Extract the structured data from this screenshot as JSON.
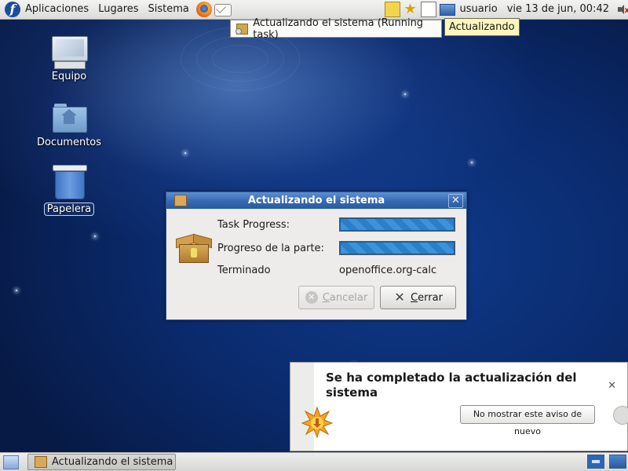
{
  "top_panel": {
    "menus": [
      "Aplicaciones",
      "Lugares",
      "Sistema"
    ],
    "launchers": [
      "firefox-icon",
      "mail-icon"
    ],
    "tray_icons": [
      "note-icon",
      "star-icon",
      "document-icon",
      "network-icon"
    ],
    "user": "usuario",
    "clock": "vie 13 de jun, 00:42",
    "volume": "volume-muted-icon"
  },
  "tooltips": {
    "running_task": "Actualizando el sistema (Running task)",
    "hover": "Actualizando"
  },
  "desktop_icons": [
    {
      "label": "Equipo",
      "icon": "computer-icon"
    },
    {
      "label": "Documentos",
      "icon": "home-folder-icon"
    },
    {
      "label": "Papelera",
      "icon": "trash-icon",
      "selected": true
    }
  ],
  "dialog": {
    "title": "Actualizando el sistema",
    "rows": [
      {
        "label": "Task Progress:",
        "progress": 1.0
      },
      {
        "label": "Progreso de la parte:",
        "progress": 1.0
      },
      {
        "label": "Terminado",
        "value": "openoffice.org-calc"
      }
    ],
    "buttons": {
      "cancel": {
        "label": "Cancelar",
        "enabled": false
      },
      "close": {
        "label": "Cerrar",
        "enabled": true
      }
    }
  },
  "notification": {
    "title": "Se ha completado la actualización del sistema",
    "action": "No mostrar este aviso de nuevo",
    "close_glyph": "✕"
  },
  "bottom_panel": {
    "task": "Actualizando el sistema",
    "workspaces": 2,
    "active_workspace": 1
  },
  "colors": {
    "titlebar": "#3569b0",
    "progress_fill": "#2f86cf",
    "desktop": "#0a2a6c",
    "tooltip_yellow": "#fff6bd"
  }
}
